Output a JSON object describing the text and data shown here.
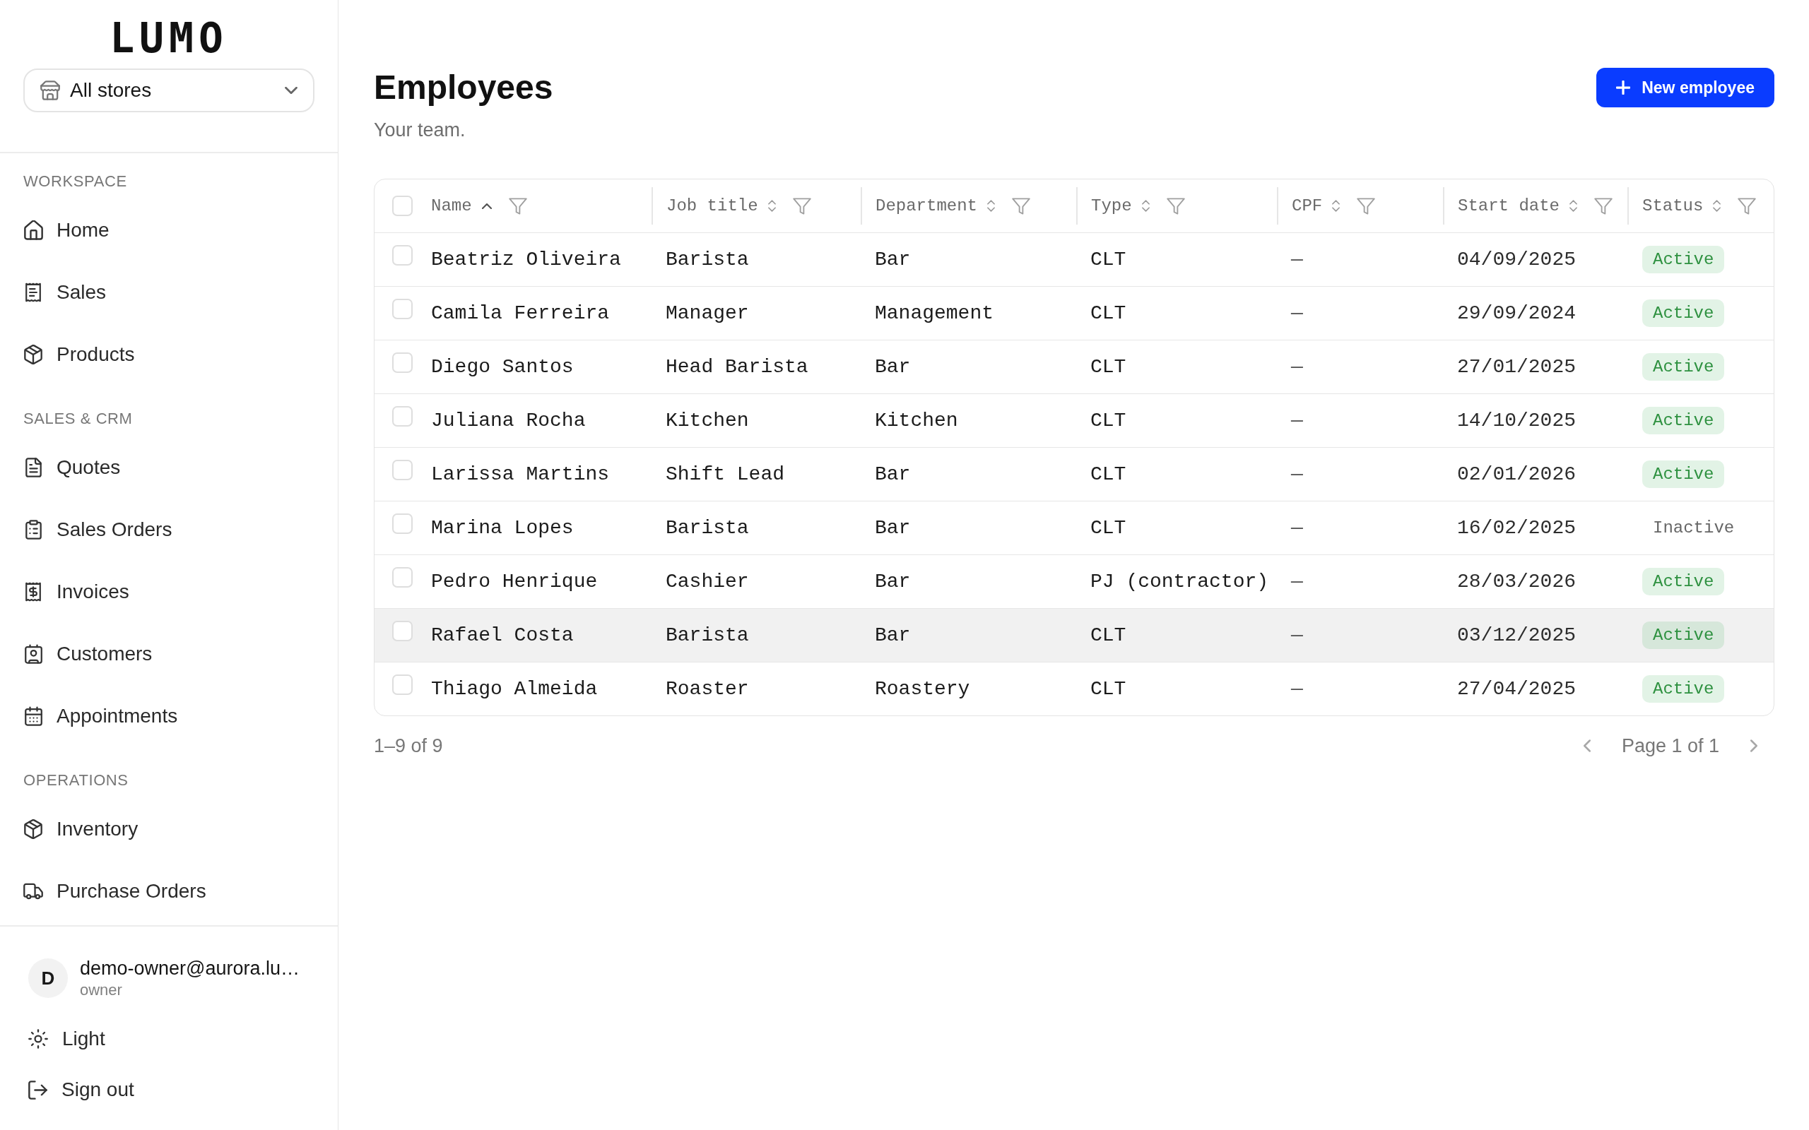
{
  "sidebar": {
    "logo": "LUMO",
    "store_select": {
      "value": "All stores"
    },
    "sections": [
      {
        "title": "WORKSPACE",
        "items": [
          {
            "label": "Home",
            "selected": false
          },
          {
            "label": "Sales",
            "selected": false
          },
          {
            "label": "Products",
            "selected": false
          }
        ]
      },
      {
        "title": "SALES & CRM",
        "items": [
          {
            "label": "Quotes",
            "selected": false
          },
          {
            "label": "Sales Orders",
            "selected": false
          },
          {
            "label": "Invoices",
            "selected": false
          },
          {
            "label": "Customers",
            "selected": false
          },
          {
            "label": "Appointments",
            "selected": false
          }
        ]
      },
      {
        "title": "OPERATIONS",
        "items": [
          {
            "label": "Inventory",
            "selected": false
          },
          {
            "label": "Purchase Orders",
            "selected": false
          }
        ]
      }
    ],
    "user": {
      "avatar": "D",
      "email": "demo-owner@aurora.lu…",
      "role": "owner"
    },
    "theme_toggle": "Light",
    "sign_out": "Sign out"
  },
  "header": {
    "title": "Employees",
    "subtitle": "Your team.",
    "new_button": "New employee"
  },
  "table": {
    "select_all": {
      "checked": false
    },
    "columns": [
      {
        "label": "Name",
        "sorted": true
      },
      {
        "label": "Job title",
        "sorted": false
      },
      {
        "label": "Department",
        "sorted": false
      },
      {
        "label": "Type",
        "sorted": false
      },
      {
        "label": "CPF",
        "sorted": false
      },
      {
        "label": "Start date",
        "sorted": false
      },
      {
        "label": "Status",
        "sorted": false
      }
    ],
    "rows": [
      {
        "name": "Beatriz Oliveira",
        "job_title": "Barista",
        "department": "Bar",
        "type": "CLT",
        "cpf": "—",
        "start_date": "04/09/2025",
        "status": {
          "label": "Active",
          "active": true
        },
        "checked": false,
        "highlighted": false
      },
      {
        "name": "Camila Ferreira",
        "job_title": "Manager",
        "department": "Management",
        "type": "CLT",
        "cpf": "—",
        "start_date": "29/09/2024",
        "status": {
          "label": "Active",
          "active": true
        },
        "checked": false,
        "highlighted": false
      },
      {
        "name": "Diego Santos",
        "job_title": "Head Barista",
        "department": "Bar",
        "type": "CLT",
        "cpf": "—",
        "start_date": "27/01/2025",
        "status": {
          "label": "Active",
          "active": true
        },
        "checked": false,
        "highlighted": false
      },
      {
        "name": "Juliana Rocha",
        "job_title": "Kitchen",
        "department": "Kitchen",
        "type": "CLT",
        "cpf": "—",
        "start_date": "14/10/2025",
        "status": {
          "label": "Active",
          "active": true
        },
        "checked": false,
        "highlighted": false
      },
      {
        "name": "Larissa Martins",
        "job_title": "Shift Lead",
        "department": "Bar",
        "type": "CLT",
        "cpf": "—",
        "start_date": "02/01/2026",
        "status": {
          "label": "Active",
          "active": true
        },
        "checked": false,
        "highlighted": false
      },
      {
        "name": "Marina Lopes",
        "job_title": "Barista",
        "department": "Bar",
        "type": "CLT",
        "cpf": "—",
        "start_date": "16/02/2025",
        "status": {
          "label": "Inactive",
          "active": false
        },
        "checked": false,
        "highlighted": false
      },
      {
        "name": "Pedro Henrique",
        "job_title": "Cashier",
        "department": "Bar",
        "type": "PJ (contractor)",
        "cpf": "—",
        "start_date": "28/03/2026",
        "status": {
          "label": "Active",
          "active": true
        },
        "checked": false,
        "highlighted": false
      },
      {
        "name": "Rafael Costa",
        "job_title": "Barista",
        "department": "Bar",
        "type": "CLT",
        "cpf": "—",
        "start_date": "03/12/2025",
        "status": {
          "label": "Active",
          "active": true
        },
        "checked": false,
        "highlighted": true
      },
      {
        "name": "Thiago Almeida",
        "job_title": "Roaster",
        "department": "Roastery",
        "type": "CLT",
        "cpf": "—",
        "start_date": "27/04/2025",
        "status": {
          "label": "Active",
          "active": true
        },
        "checked": false,
        "highlighted": false
      }
    ]
  },
  "pagination": {
    "range": "1–9 of 9",
    "page": "Page 1 of 1",
    "previous_disabled": true,
    "next_disabled": true
  }
}
